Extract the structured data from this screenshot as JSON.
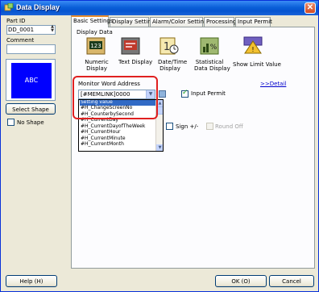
{
  "window": {
    "title": "Data Display"
  },
  "left": {
    "part_id_label": "Part ID",
    "part_id_value": "DD_0001",
    "comment_label": "Comment",
    "comment_value": "",
    "preview_text": "ABC",
    "select_shape": "Select Shape",
    "no_shape": "No Shape"
  },
  "tabs": [
    {
      "label": "Basic Settings"
    },
    {
      "label": "Display Settings"
    },
    {
      "label": "Alarm/Color Settings"
    },
    {
      "label": "Processing"
    },
    {
      "label": "Input Permit"
    }
  ],
  "basic": {
    "display_data_label": "Display Data",
    "types": [
      {
        "label": "Numeric\nDisplay",
        "icon": "numeric-display-icon"
      },
      {
        "label": "Text Display",
        "icon": "text-display-icon"
      },
      {
        "label": "Date/Time\nDisplay",
        "icon": "date-time-display-icon"
      },
      {
        "label": "Statistical\nData Display",
        "icon": "statistical-display-icon"
      },
      {
        "label": "Show Limit Value",
        "icon": "show-limit-value-icon"
      }
    ],
    "monitor_label": "Monitor Word Address",
    "detail_link": ">>Detail",
    "address_value": "[#MEMLINK]0000",
    "input_permit": "Input Permit",
    "sign_label": "Sign +/-",
    "round_off": "Round Off",
    "dropdown_items": [
      "Setting  value",
      "#H_ChangeScreenNo",
      "#H_CounterbySecond",
      "#H_CurrentDay",
      "#H_CurrentDayofTheWeek",
      "#H_CurrentHour",
      "#H_CurrentMinute",
      "#H_CurrentMonth"
    ]
  },
  "footer": {
    "help": "Help (H)",
    "ok": "OK (O)",
    "cancel": "Cancel"
  },
  "colors": {
    "accent": "#0054e3",
    "preview": "#0000ff",
    "selection": "#316ac5",
    "highlight": "#e02020"
  }
}
